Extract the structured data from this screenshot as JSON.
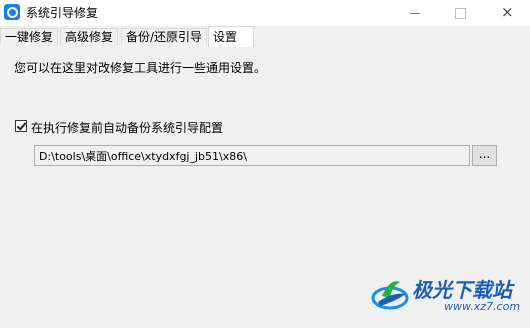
{
  "window": {
    "title": "系统引导修复",
    "controls": {
      "minimize": "minimize",
      "maximize": "maximize",
      "close": "×"
    }
  },
  "tabs": [
    {
      "label": "一键修复",
      "active": false
    },
    {
      "label": "高级修复",
      "active": false
    },
    {
      "label": "备份/还原引导",
      "active": false
    },
    {
      "label": "设置",
      "active": true
    }
  ],
  "settings": {
    "description": "您可以在这里对改修复工具进行一些通用设置。",
    "auto_backup_label": "在执行修复前自动备份系统引导配置",
    "auto_backup_checked": true,
    "backup_path": "D:\\tools\\桌面\\office\\xtydxfgj_jb51\\x86\\",
    "browse_label": "..."
  },
  "watermark": {
    "name": "极光下载站",
    "url": "www.xz7.com",
    "brand_color": "#1a5fb4"
  }
}
